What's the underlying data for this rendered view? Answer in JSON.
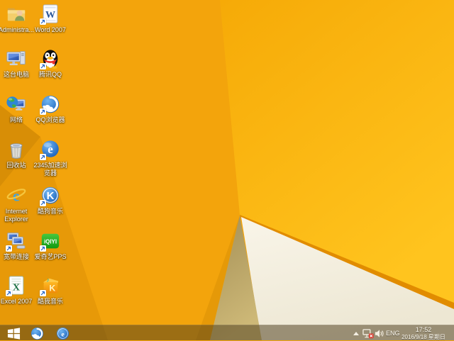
{
  "wallpaper": {
    "style": "windows-8.1-default-orange-facets",
    "colors": {
      "main_orange": "#F3A40C",
      "dark_left_wedge": "#D88E06",
      "lower_left_facet": "#E79908",
      "bright_yellow_facet": "#FBB70D",
      "white_facet": "#F4F0E2",
      "tan_fold_facet": "#BCA566",
      "fold_ridge": "#E18C00"
    }
  },
  "desktop": {
    "icons": [
      {
        "id": "administrator",
        "label": "Administra..."
      },
      {
        "id": "word-2007",
        "label": "Word 2007"
      },
      {
        "id": "this-pc",
        "label": "这台电脑"
      },
      {
        "id": "tencent-qq",
        "label": "腾讯QQ"
      },
      {
        "id": "network",
        "label": "网络"
      },
      {
        "id": "qq-browser",
        "label": "QQ浏览器"
      },
      {
        "id": "recycle-bin",
        "label": "回收站"
      },
      {
        "id": "2345-browser",
        "label": "2345加速浏\n览器"
      },
      {
        "id": "internet-explorer",
        "label": "Internet\nExplorer"
      },
      {
        "id": "kugou-music",
        "label": "酷狗音乐"
      },
      {
        "id": "broadband",
        "label": "宽带连接"
      },
      {
        "id": "iqiyi-pps",
        "label": "爱奇艺PPS"
      },
      {
        "id": "excel-2007",
        "label": "Excel 2007"
      },
      {
        "id": "kuwo-music",
        "label": "酷我音乐"
      }
    ]
  },
  "taskbar": {
    "pinned": [
      {
        "id": "start",
        "icon": "windows-logo"
      },
      {
        "id": "qq-browser",
        "icon": "qq-browser-globe"
      },
      {
        "id": "2345-browser",
        "icon": "blue-e-browser"
      }
    ],
    "tray": {
      "icons": [
        "show-hidden-chevron",
        "network-disconnected",
        "volume"
      ],
      "language": "ENG",
      "time": "17:52",
      "date": "2016/9/18 星期日"
    }
  }
}
